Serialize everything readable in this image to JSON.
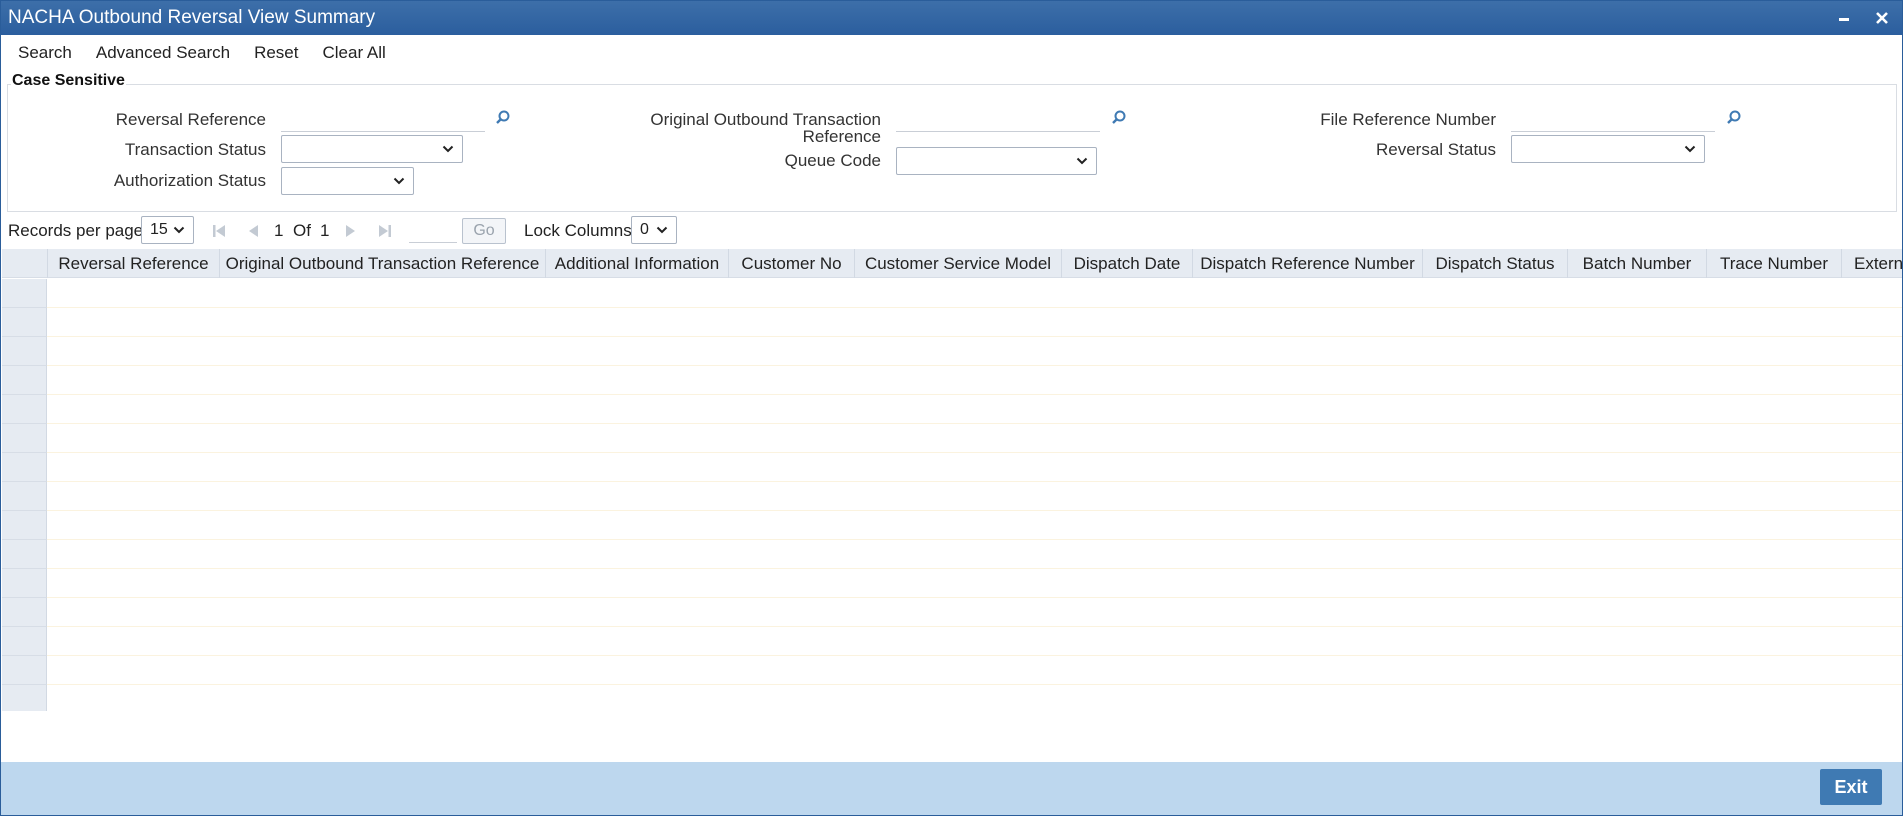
{
  "window": {
    "title": "NACHA Outbound Reversal View Summary"
  },
  "toolbar": {
    "search": "Search",
    "advanced_search": "Advanced Search",
    "reset": "Reset",
    "clear_all": "Clear All"
  },
  "panel": {
    "legend": "Case Sensitive",
    "fields": {
      "reversal_reference": {
        "label": "Reversal Reference",
        "value": ""
      },
      "transaction_status": {
        "label": "Transaction Status",
        "value": ""
      },
      "authorization_status": {
        "label": "Authorization Status",
        "value": ""
      },
      "original_outbound": {
        "label_line1": "Original Outbound Transaction",
        "label_line2": "Reference",
        "value": ""
      },
      "queue_code": {
        "label": "Queue Code",
        "value": ""
      },
      "file_reference_number": {
        "label": "File Reference Number",
        "value": ""
      },
      "reversal_status": {
        "label": "Reversal Status",
        "value": ""
      }
    }
  },
  "pager": {
    "records_per_page_label": "Records per page",
    "records_per_page": "15",
    "current_page": "1",
    "of_label": "Of",
    "total_pages": "1",
    "go_label": "Go",
    "lock_columns_label": "Lock Columns",
    "lock_columns": "0"
  },
  "grid": {
    "columns": [
      "Reversal Reference",
      "Original Outbound Transaction Reference",
      "Additional Information",
      "Customer No",
      "Customer Service Model",
      "Dispatch Date",
      "Dispatch Reference Number",
      "Dispatch Status",
      "Batch Number",
      "Trace Number",
      "Extern"
    ],
    "row_count": 15
  },
  "footer": {
    "exit_label": "Exit"
  },
  "colors": {
    "titlebar": "#2b5e9e",
    "footer": "#bdd7ee",
    "exit_button": "#3f7ab3",
    "grid_header": "#e6ebf2"
  },
  "icons": {
    "minimize": "minimize-icon",
    "close": "close-icon",
    "lookup": "search-icon",
    "dropdown": "chevron-down-icon"
  }
}
